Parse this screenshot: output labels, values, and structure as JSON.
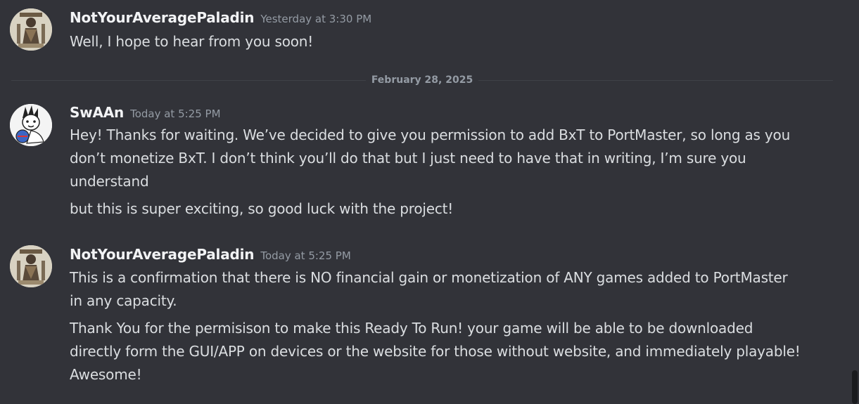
{
  "date_divider": "February 28, 2025",
  "messages": [
    {
      "author": "NotYourAveragePaladin",
      "timestamp": "Yesterday at 3:30 PM",
      "avatar_icon": "paladin-avatar-icon",
      "lines": [
        "Well, I hope to hear from you soon!"
      ]
    },
    {
      "author": "SwAAn",
      "timestamp": "Today at 5:25 PM",
      "avatar_icon": "cartoon-kid-avatar-icon",
      "lines": [
        "Hey! Thanks for waiting. We’ve decided to give you permission to add BxT to PortMaster, so long as you don’t monetize BxT. I don’t think you’ll do that but I just need to have that in writing, I’m sure you understand",
        "but this is super exciting, so good luck with the project!"
      ]
    },
    {
      "author": "NotYourAveragePaladin",
      "timestamp": "Today at 5:25 PM",
      "avatar_icon": "paladin-avatar-icon",
      "lines": [
        "This is a confirmation that there is NO financial gain or monetization of ANY games added to PortMaster in any capacity.",
        "Thank You for the permisison to make this Ready To Run! your game will be able to be downloaded directly form the GUI/APP on devices or the website for those without website, and immediately playable! Awesome!"
      ]
    }
  ],
  "colors": {
    "background": "#323339",
    "text": "#dbdee1",
    "username": "#f2f3f5",
    "timestamp": "#949ba4"
  }
}
